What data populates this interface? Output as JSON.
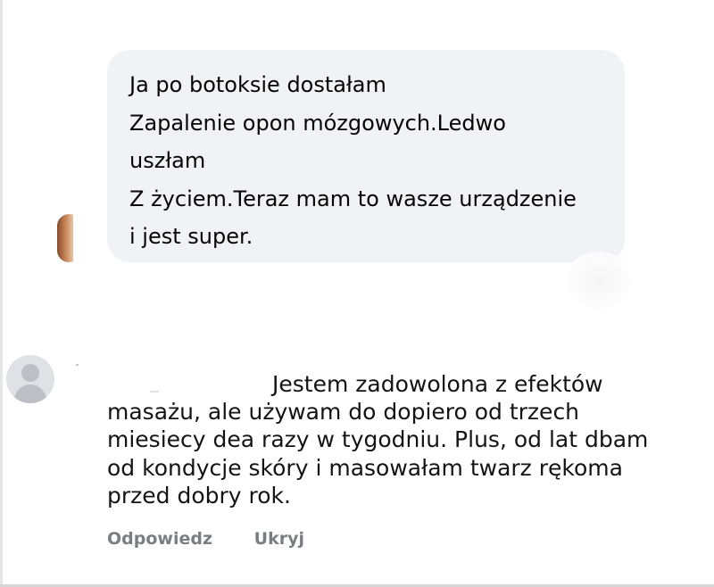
{
  "comment_one": {
    "bubble_lines": [
      "Ja po botoksie dostałam",
      "Zapalenie opon mózgowych.Ledwo",
      "uszłam",
      "Z życiem.Teraz mam to wasze urządzenie",
      "i jest super."
    ]
  },
  "comment_two": {
    "text_lines": [
      "Jestem zadowolona z efektów",
      "masażu, ale używam do dopiero od trzech",
      "miesiecy dea razy w tygodniu. Plus, od lat dbam",
      "od kondycje skóry i masowałam twarz rękoma",
      "przed dobry rok."
    ],
    "actions": {
      "reply": "Odpowiedz",
      "hide": "Ukryj"
    }
  },
  "colors": {
    "bubble_background": "#f0f2f5",
    "text": "#050505",
    "action_text": "#7a7d82",
    "default_avatar": "#dfe1e5"
  },
  "icons": [
    "default-avatar-icon"
  ]
}
